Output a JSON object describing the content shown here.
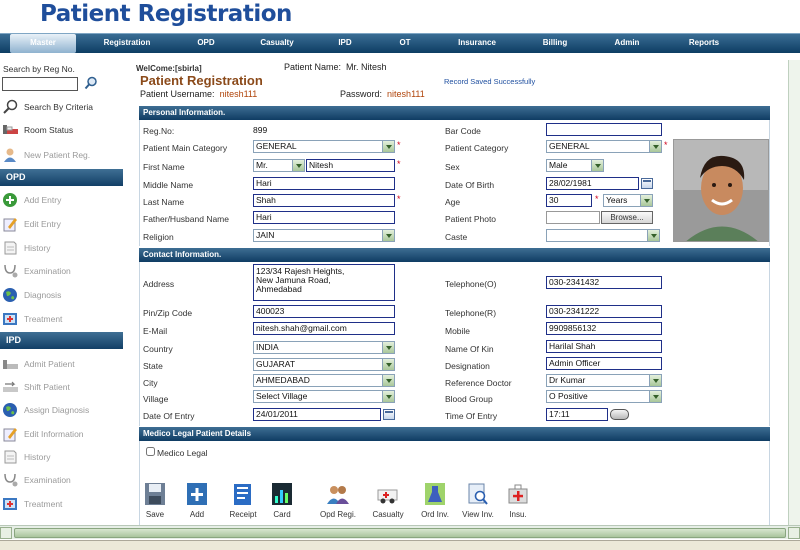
{
  "app": {
    "title": "Patient Registration"
  },
  "nav": [
    {
      "label": "Master",
      "active": true
    },
    {
      "label": "Registration"
    },
    {
      "label": "OPD"
    },
    {
      "label": "Casualty"
    },
    {
      "label": "IPD"
    },
    {
      "label": "OT"
    },
    {
      "label": "Insurance"
    },
    {
      "label": "Billing"
    },
    {
      "label": "Admin"
    },
    {
      "label": "Reports"
    }
  ],
  "sidebar": {
    "search_label": "Search by Reg No.",
    "search_by_criteria": "Search By Criteria",
    "room_status": "Room Status",
    "new_patient": "New Patient Reg.",
    "opd_header": "OPD",
    "opd_items": [
      "Add Entry",
      "Edit Entry",
      "History",
      "Examination",
      "Diagnosis",
      "Treatment"
    ],
    "ipd_header": "IPD",
    "ipd_items": [
      "Admit Patient",
      "Shift Patient",
      "Assign Diagnosis",
      "Edit Information",
      "History",
      "Examination",
      "Treatment"
    ]
  },
  "header": {
    "welcome": "WelCome:[sbirla]",
    "patient_name_label": "Patient Name:",
    "patient_name": "Mr. Nitesh",
    "page_title": "Patient Registration",
    "saved_msg": "Record Saved Successfully",
    "username_label": "Patient Username:",
    "username": "nitesh111",
    "password_label": "Password:",
    "password": "nitesh111"
  },
  "personal": {
    "section": "Personal Information.",
    "reg_no_label": "Reg.No:",
    "reg_no": "899",
    "barcode_label": "Bar Code",
    "barcode": "",
    "main_cat_label": "Patient Main Category",
    "main_cat": "GENERAL",
    "cat_label": "Patient Category",
    "cat": "GENERAL",
    "first_name_label": "First Name",
    "title": "Mr.",
    "first_name": "Nitesh",
    "sex_label": "Sex",
    "sex": "Male",
    "middle_name_label": "Middle Name",
    "middle_name": "Hari",
    "dob_label": "Date Of Birth",
    "dob": "28/02/1981",
    "last_name_label": "Last Name",
    "last_name": "Shah",
    "age_label": "Age",
    "age": "30",
    "age_unit": "Years",
    "father_label": "Father/Husband Name",
    "father": "Hari",
    "photo_label": "Patient Photo",
    "browse": "Browse...",
    "religion_label": "Religion",
    "religion": "JAIN",
    "caste_label": "Caste",
    "caste": ""
  },
  "contact": {
    "section": "Contact Information.",
    "address_label": "Address",
    "address_lines": [
      "123/34 Rajesh Heights,",
      "New Jamuna Road,",
      "Ahmedabad"
    ],
    "tel_o_label": "Telephone(O)",
    "tel_o": "030-2341432",
    "pin_label": "Pin/Zip Code",
    "pin": "400023",
    "tel_r_label": "Telephone(R)",
    "tel_r": "030-2341222",
    "email_label": "E-Mail",
    "email": "nitesh.shah@gmail.com",
    "mobile_label": "Mobile",
    "mobile": "9909856132",
    "country_label": "Country",
    "country": "INDIA",
    "kin_label": "Name Of Kin",
    "kin": "Harilal Shah",
    "state_label": "State",
    "state": "GUJARAT",
    "designation_label": "Designation",
    "designation": "Admin Officer",
    "city_label": "City",
    "city": "AHMEDABAD",
    "ref_doc_label": "Reference Doctor",
    "ref_doc": "Dr Kumar",
    "village_label": "Village",
    "village": "Select Village",
    "blood_label": "Blood Group",
    "blood": "O Positive",
    "doe_label": "Date Of Entry",
    "doe": "24/01/2011",
    "toe_label": "Time Of Entry",
    "toe": "17:11"
  },
  "medico": {
    "section": "Medico Legal Patient Details",
    "checkbox_label": "Medico Legal"
  },
  "toolbar": [
    "Save",
    "Add",
    "Receipt",
    "Card",
    "Opd Regi.",
    "Casualty",
    "Ord Inv.",
    "View Inv.",
    "Insu."
  ],
  "colors": {
    "nav": "#0d3d63",
    "title": "#1f4e9b",
    "page_title": "#8b4a1a",
    "credentials": "#b0440a",
    "required": "#d0021b"
  }
}
